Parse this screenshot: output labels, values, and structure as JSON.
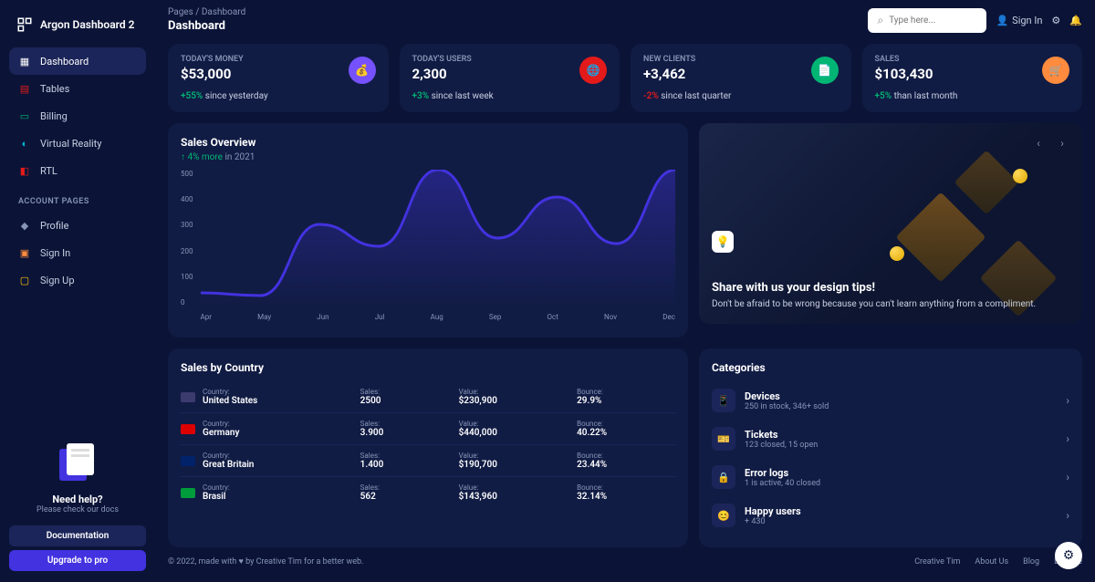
{
  "brand": "Argon Dashboard 2",
  "breadcrumb": "Pages  /  Dashboard",
  "page_title": "Dashboard",
  "search": {
    "placeholder": "Type here..."
  },
  "top": {
    "signin": "Sign In"
  },
  "nav": {
    "items": [
      "Dashboard",
      "Tables",
      "Billing",
      "Virtual Reality",
      "RTL"
    ],
    "section": "ACCOUNT PAGES",
    "account": [
      "Profile",
      "Sign In",
      "Sign Up"
    ]
  },
  "help": {
    "title": "Need help?",
    "sub": "Please check our docs",
    "doc": "Documentation",
    "upgrade": "Upgrade to pro"
  },
  "stats": [
    {
      "label": "TODAY'S MONEY",
      "value": "$53,000",
      "pct": "+55%",
      "rest": "since yesterday",
      "pos": true,
      "icon": "money",
      "color": "#7551ff"
    },
    {
      "label": "TODAY'S USERS",
      "value": "2,300",
      "pct": "+3%",
      "rest": "since last week",
      "pos": true,
      "icon": "globe",
      "color": "#e31a1a"
    },
    {
      "label": "NEW CLIENTS",
      "value": "+3,462",
      "pct": "-2%",
      "rest": "since last quarter",
      "pos": false,
      "icon": "doc",
      "color": "#01b574"
    },
    {
      "label": "SALES",
      "value": "$103,430",
      "pct": "+5%",
      "rest": "than last month",
      "pos": true,
      "icon": "cart",
      "color": "#ff8b3e"
    }
  ],
  "overview": {
    "title": "Sales Overview",
    "sub_pct": "4% more",
    "sub_rest": "in 2021"
  },
  "chart_data": {
    "type": "line",
    "title": "Sales Overview",
    "xlabel": "",
    "ylabel": "",
    "ylim": [
      0,
      500
    ],
    "y_ticks": [
      0,
      100,
      200,
      300,
      400,
      500
    ],
    "categories": [
      "Apr",
      "May",
      "Jun",
      "Jul",
      "Aug",
      "Sep",
      "Oct",
      "Nov",
      "Dec"
    ],
    "values": [
      50,
      40,
      300,
      220,
      500,
      250,
      400,
      230,
      500
    ]
  },
  "hero": {
    "title": "Share with us your design tips!",
    "desc": "Don't be afraid to be wrong because you can't learn anything from a compliment."
  },
  "sales_by_country": {
    "title": "Sales by Country",
    "headers": {
      "country": "Country:",
      "sales": "Sales:",
      "value": "Value:",
      "bounce": "Bounce:"
    },
    "rows": [
      {
        "flag": "#3c3b6e",
        "country": "United States",
        "sales": "2500",
        "value": "$230,900",
        "bounce": "29.9%"
      },
      {
        "flag": "#dd0000",
        "country": "Germany",
        "sales": "3.900",
        "value": "$440,000",
        "bounce": "40.22%"
      },
      {
        "flag": "#012169",
        "country": "Great Britain",
        "sales": "1.400",
        "value": "$190,700",
        "bounce": "23.44%"
      },
      {
        "flag": "#009c3b",
        "country": "Brasil",
        "sales": "562",
        "value": "$143,960",
        "bounce": "32.14%"
      }
    ]
  },
  "categories": {
    "title": "Categories",
    "items": [
      {
        "icon": "📱",
        "title": "Devices",
        "sub": "250 in stock, 346+ sold"
      },
      {
        "icon": "🎫",
        "title": "Tickets",
        "sub": "123 closed, 15 open"
      },
      {
        "icon": "🔒",
        "title": "Error logs",
        "sub": "1 is active, 40 closed"
      },
      {
        "icon": "😊",
        "title": "Happy users",
        "sub": "+ 430"
      }
    ]
  },
  "footer": {
    "left": "© 2022, made with ♥ by Creative Tim for a better web.",
    "links": [
      "Creative Tim",
      "About Us",
      "Blog",
      "License"
    ]
  }
}
